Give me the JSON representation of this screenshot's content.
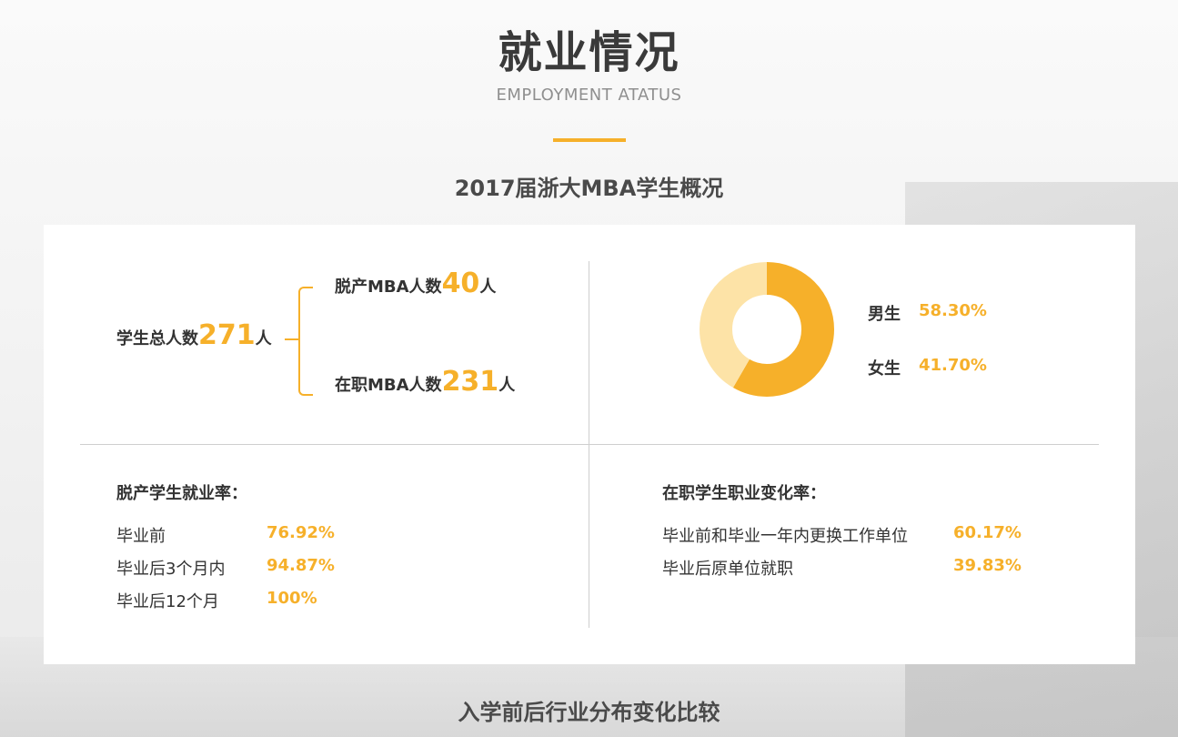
{
  "header": {
    "title": "就业情况",
    "subtitle": "EMPLOYMENT ATATUS",
    "section_title": "2017届浙大MBA学生概况",
    "next_section_title": "入学前后行业分布变化比较"
  },
  "students": {
    "total_label": "学生总人数",
    "total": "271",
    "unit": "人",
    "fulltime_label": "脱产MBA人数",
    "fulltime": "40",
    "parttime_label": "在职MBA人数",
    "parttime": "231"
  },
  "chart_data": {
    "type": "pie",
    "categories": [
      "男生",
      "女生"
    ],
    "values": [
      58.3,
      41.7
    ],
    "value_labels": [
      "58.30%",
      "41.70%"
    ],
    "colors": [
      "#f6b02a",
      "#fde3a7"
    ],
    "donut": true
  },
  "fulltime_employment": {
    "title": "脱产学生就业率：",
    "rows": [
      {
        "label": "毕业前",
        "value": "76.92%"
      },
      {
        "label": "毕业后3个月内",
        "value": "94.87%"
      },
      {
        "label": "毕业后12个月",
        "value": "100%"
      }
    ]
  },
  "parttime_change": {
    "title": "在职学生职业变化率：",
    "rows": [
      {
        "label": "毕业前和毕业一年内更换工作单位",
        "value": "60.17%"
      },
      {
        "label": "毕业后原单位就职",
        "value": "39.83%"
      }
    ]
  },
  "colors": {
    "accent": "#f6b02a",
    "accent_light": "#fde3a7"
  }
}
